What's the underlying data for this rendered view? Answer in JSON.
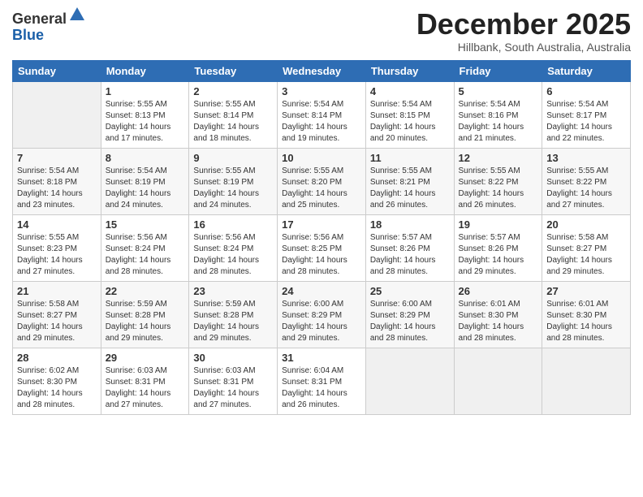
{
  "header": {
    "logo_general": "General",
    "logo_blue": "Blue",
    "month_title": "December 2025",
    "subtitle": "Hillbank, South Australia, Australia"
  },
  "days_of_week": [
    "Sunday",
    "Monday",
    "Tuesday",
    "Wednesday",
    "Thursday",
    "Friday",
    "Saturday"
  ],
  "weeks": [
    [
      {
        "day": "",
        "sunrise": "",
        "sunset": "",
        "daylight": ""
      },
      {
        "day": "1",
        "sunrise": "Sunrise: 5:55 AM",
        "sunset": "Sunset: 8:13 PM",
        "daylight": "Daylight: 14 hours and 17 minutes."
      },
      {
        "day": "2",
        "sunrise": "Sunrise: 5:55 AM",
        "sunset": "Sunset: 8:14 PM",
        "daylight": "Daylight: 14 hours and 18 minutes."
      },
      {
        "day": "3",
        "sunrise": "Sunrise: 5:54 AM",
        "sunset": "Sunset: 8:14 PM",
        "daylight": "Daylight: 14 hours and 19 minutes."
      },
      {
        "day": "4",
        "sunrise": "Sunrise: 5:54 AM",
        "sunset": "Sunset: 8:15 PM",
        "daylight": "Daylight: 14 hours and 20 minutes."
      },
      {
        "day": "5",
        "sunrise": "Sunrise: 5:54 AM",
        "sunset": "Sunset: 8:16 PM",
        "daylight": "Daylight: 14 hours and 21 minutes."
      },
      {
        "day": "6",
        "sunrise": "Sunrise: 5:54 AM",
        "sunset": "Sunset: 8:17 PM",
        "daylight": "Daylight: 14 hours and 22 minutes."
      }
    ],
    [
      {
        "day": "7",
        "sunrise": "Sunrise: 5:54 AM",
        "sunset": "Sunset: 8:18 PM",
        "daylight": "Daylight: 14 hours and 23 minutes."
      },
      {
        "day": "8",
        "sunrise": "Sunrise: 5:54 AM",
        "sunset": "Sunset: 8:19 PM",
        "daylight": "Daylight: 14 hours and 24 minutes."
      },
      {
        "day": "9",
        "sunrise": "Sunrise: 5:55 AM",
        "sunset": "Sunset: 8:19 PM",
        "daylight": "Daylight: 14 hours and 24 minutes."
      },
      {
        "day": "10",
        "sunrise": "Sunrise: 5:55 AM",
        "sunset": "Sunset: 8:20 PM",
        "daylight": "Daylight: 14 hours and 25 minutes."
      },
      {
        "day": "11",
        "sunrise": "Sunrise: 5:55 AM",
        "sunset": "Sunset: 8:21 PM",
        "daylight": "Daylight: 14 hours and 26 minutes."
      },
      {
        "day": "12",
        "sunrise": "Sunrise: 5:55 AM",
        "sunset": "Sunset: 8:22 PM",
        "daylight": "Daylight: 14 hours and 26 minutes."
      },
      {
        "day": "13",
        "sunrise": "Sunrise: 5:55 AM",
        "sunset": "Sunset: 8:22 PM",
        "daylight": "Daylight: 14 hours and 27 minutes."
      }
    ],
    [
      {
        "day": "14",
        "sunrise": "Sunrise: 5:55 AM",
        "sunset": "Sunset: 8:23 PM",
        "daylight": "Daylight: 14 hours and 27 minutes."
      },
      {
        "day": "15",
        "sunrise": "Sunrise: 5:56 AM",
        "sunset": "Sunset: 8:24 PM",
        "daylight": "Daylight: 14 hours and 28 minutes."
      },
      {
        "day": "16",
        "sunrise": "Sunrise: 5:56 AM",
        "sunset": "Sunset: 8:24 PM",
        "daylight": "Daylight: 14 hours and 28 minutes."
      },
      {
        "day": "17",
        "sunrise": "Sunrise: 5:56 AM",
        "sunset": "Sunset: 8:25 PM",
        "daylight": "Daylight: 14 hours and 28 minutes."
      },
      {
        "day": "18",
        "sunrise": "Sunrise: 5:57 AM",
        "sunset": "Sunset: 8:26 PM",
        "daylight": "Daylight: 14 hours and 28 minutes."
      },
      {
        "day": "19",
        "sunrise": "Sunrise: 5:57 AM",
        "sunset": "Sunset: 8:26 PM",
        "daylight": "Daylight: 14 hours and 29 minutes."
      },
      {
        "day": "20",
        "sunrise": "Sunrise: 5:58 AM",
        "sunset": "Sunset: 8:27 PM",
        "daylight": "Daylight: 14 hours and 29 minutes."
      }
    ],
    [
      {
        "day": "21",
        "sunrise": "Sunrise: 5:58 AM",
        "sunset": "Sunset: 8:27 PM",
        "daylight": "Daylight: 14 hours and 29 minutes."
      },
      {
        "day": "22",
        "sunrise": "Sunrise: 5:59 AM",
        "sunset": "Sunset: 8:28 PM",
        "daylight": "Daylight: 14 hours and 29 minutes."
      },
      {
        "day": "23",
        "sunrise": "Sunrise: 5:59 AM",
        "sunset": "Sunset: 8:28 PM",
        "daylight": "Daylight: 14 hours and 29 minutes."
      },
      {
        "day": "24",
        "sunrise": "Sunrise: 6:00 AM",
        "sunset": "Sunset: 8:29 PM",
        "daylight": "Daylight: 14 hours and 29 minutes."
      },
      {
        "day": "25",
        "sunrise": "Sunrise: 6:00 AM",
        "sunset": "Sunset: 8:29 PM",
        "daylight": "Daylight: 14 hours and 28 minutes."
      },
      {
        "day": "26",
        "sunrise": "Sunrise: 6:01 AM",
        "sunset": "Sunset: 8:30 PM",
        "daylight": "Daylight: 14 hours and 28 minutes."
      },
      {
        "day": "27",
        "sunrise": "Sunrise: 6:01 AM",
        "sunset": "Sunset: 8:30 PM",
        "daylight": "Daylight: 14 hours and 28 minutes."
      }
    ],
    [
      {
        "day": "28",
        "sunrise": "Sunrise: 6:02 AM",
        "sunset": "Sunset: 8:30 PM",
        "daylight": "Daylight: 14 hours and 28 minutes."
      },
      {
        "day": "29",
        "sunrise": "Sunrise: 6:03 AM",
        "sunset": "Sunset: 8:31 PM",
        "daylight": "Daylight: 14 hours and 27 minutes."
      },
      {
        "day": "30",
        "sunrise": "Sunrise: 6:03 AM",
        "sunset": "Sunset: 8:31 PM",
        "daylight": "Daylight: 14 hours and 27 minutes."
      },
      {
        "day": "31",
        "sunrise": "Sunrise: 6:04 AM",
        "sunset": "Sunset: 8:31 PM",
        "daylight": "Daylight: 14 hours and 26 minutes."
      },
      {
        "day": "",
        "sunrise": "",
        "sunset": "",
        "daylight": ""
      },
      {
        "day": "",
        "sunrise": "",
        "sunset": "",
        "daylight": ""
      },
      {
        "day": "",
        "sunrise": "",
        "sunset": "",
        "daylight": ""
      }
    ]
  ]
}
